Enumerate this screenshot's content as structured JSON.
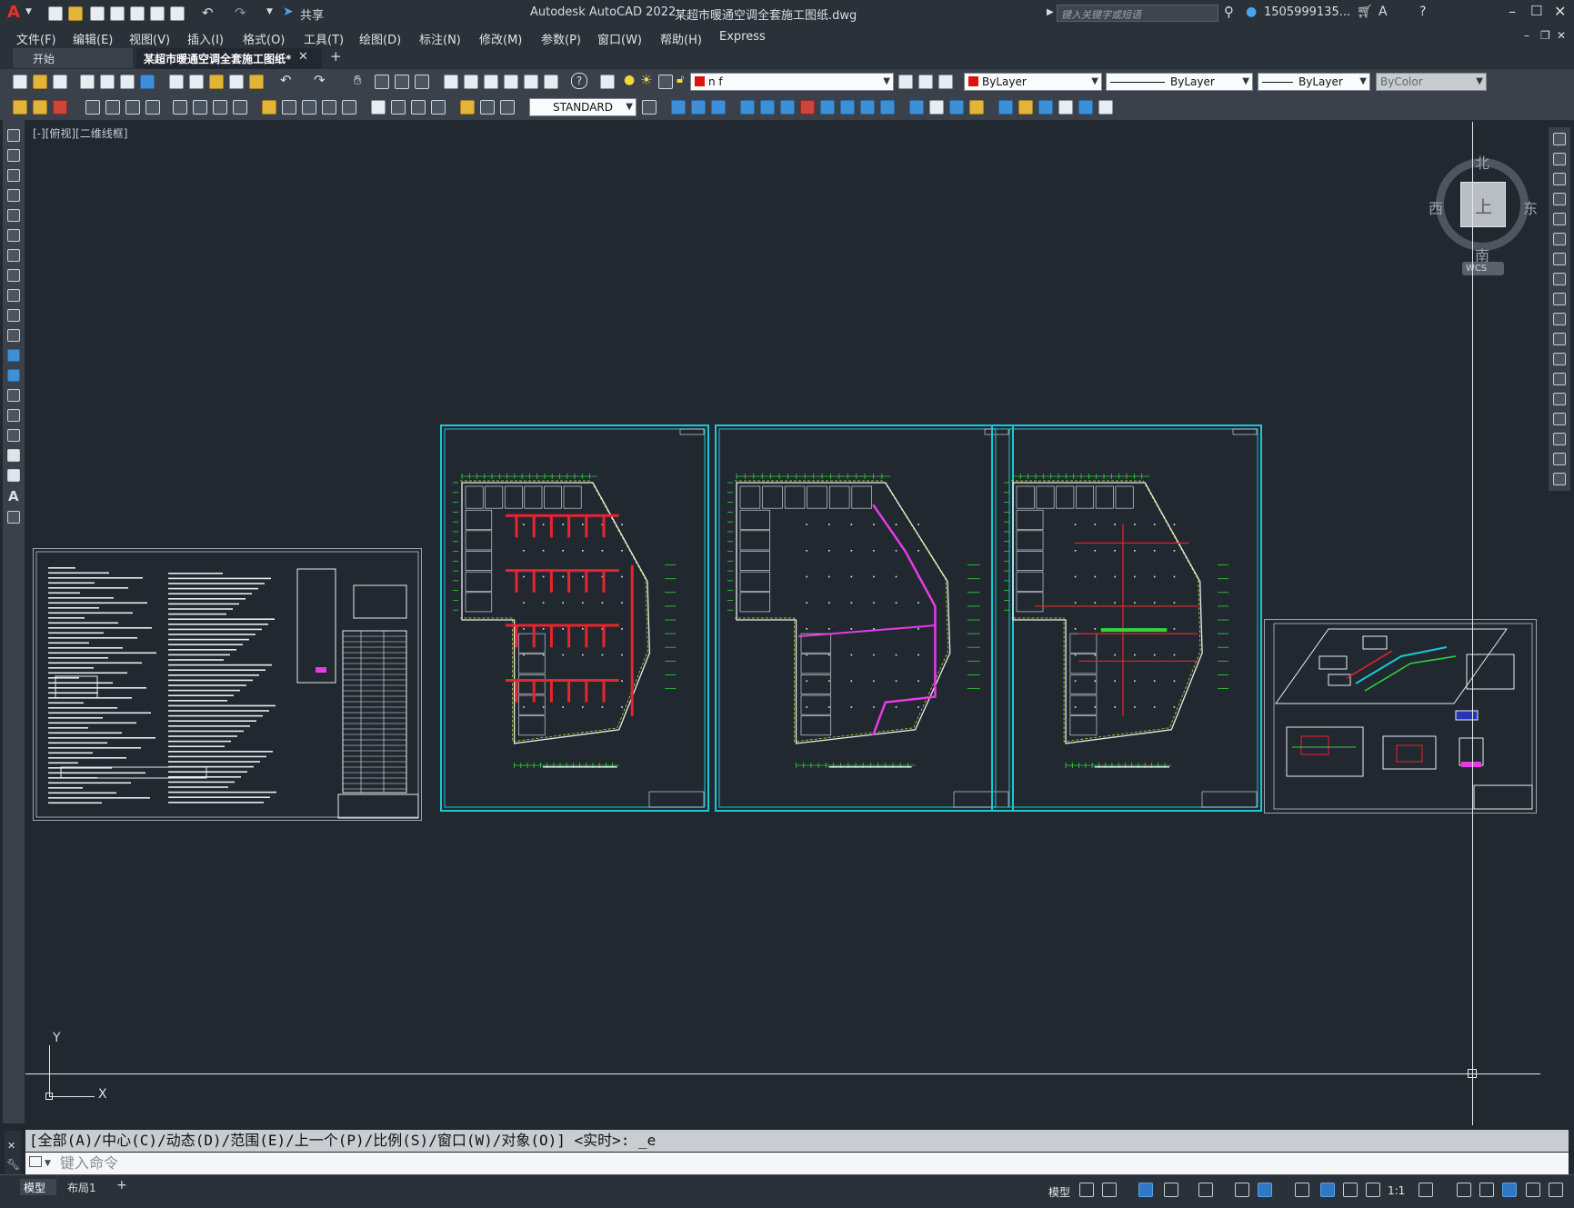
{
  "app": {
    "logo": "A",
    "title": "Autodesk AutoCAD 2022",
    "filename": "某超市暖通空调全套施工图纸.dwg",
    "share_label": "共享",
    "search_placeholder": "键入关键字或短语",
    "user": "1505999135..."
  },
  "menu": [
    "文件(F)",
    "编辑(E)",
    "视图(V)",
    "插入(I)",
    "格式(O)",
    "工具(T)",
    "绘图(D)",
    "标注(N)",
    "修改(M)",
    "参数(P)",
    "窗口(W)",
    "帮助(H)",
    "Express"
  ],
  "tabs": [
    {
      "label": "开始",
      "active": false
    },
    {
      "label": "某超市暖通空调全套施工图纸*",
      "active": true
    }
  ],
  "tab_add": "+",
  "layer": {
    "name": "n f",
    "color": "#e01010"
  },
  "properties": {
    "color": "ByLayer",
    "linetype": "ByLayer",
    "lineweight": "ByLayer",
    "plotstyle": "ByColor"
  },
  "textstyle": "STANDARD",
  "viewport_label": "[-][俯视][二维线框]",
  "viewcube": {
    "north": "北",
    "south": "南",
    "east": "东",
    "west": "西",
    "face": "上",
    "wcs": "WCS"
  },
  "ucs": {
    "x": "X",
    "y": "Y"
  },
  "command_history": "[全部(A)/中心(C)/动态(D)/范围(E)/上一个(P)/比例(S)/窗口(W)/对象(O)] <实时>: _e",
  "command_placeholder": "键入命令",
  "layout_tabs": [
    {
      "label": "模型",
      "active": true
    },
    {
      "label": "布局1",
      "active": false
    }
  ],
  "status": {
    "mode": "模型",
    "scale": "1:1"
  },
  "colors": {
    "background": "#212830",
    "frame": "#17c9d4",
    "duct_red": "#e8242c",
    "pipe_magenta": "#e63ce6",
    "wall_green": "#2fd63a",
    "dim_yellow": "#e6e23a"
  }
}
